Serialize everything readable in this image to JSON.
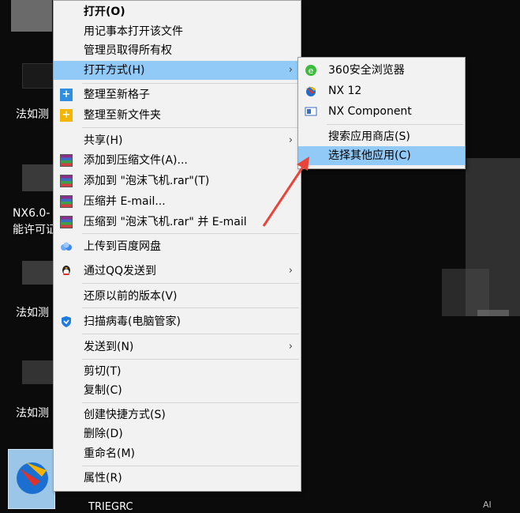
{
  "desktop": {
    "labels": [
      {
        "text": "法如测"
      },
      {
        "text": "NX6.0-"
      },
      {
        "text": "能许可证"
      },
      {
        "text": "法如测"
      },
      {
        "text": "法如测"
      },
      {
        "text": "TRIEGRC"
      }
    ],
    "watermark": "AI"
  },
  "context_menu": {
    "items": [
      {
        "label": "打开(O)",
        "bold": true
      },
      {
        "label": "用记事本打开该文件"
      },
      {
        "label": "管理员取得所有权"
      },
      {
        "label": "打开方式(H)",
        "submenu": true,
        "highlighted": true
      },
      {
        "label": "整理至新格子",
        "icon": "add-grid-icon"
      },
      {
        "label": "整理至新文件夹",
        "icon": "add-folder-icon"
      },
      {
        "label": "共享(H)",
        "submenu": true
      },
      {
        "label": "添加到压缩文件(A)...",
        "icon": "winrar-icon"
      },
      {
        "label": "添加到 \"泡沫飞机.rar\"(T)",
        "icon": "winrar-icon"
      },
      {
        "label": "压缩并 E-mail...",
        "icon": "winrar-icon"
      },
      {
        "label": "压缩到 \"泡沫飞机.rar\" 并 E-mail",
        "icon": "winrar-icon"
      },
      {
        "label": "上传到百度网盘",
        "icon": "baidu-cloud-icon"
      },
      {
        "label": "通过QQ发送到",
        "icon": "qq-icon",
        "submenu": true
      },
      {
        "label": "还原以前的版本(V)"
      },
      {
        "label": "扫描病毒(电脑管家)",
        "icon": "tencent-pc-manager-icon"
      },
      {
        "label": "发送到(N)",
        "submenu": true
      },
      {
        "label": "剪切(T)"
      },
      {
        "label": "复制(C)"
      },
      {
        "label": "创建快捷方式(S)"
      },
      {
        "label": "删除(D)"
      },
      {
        "label": "重命名(M)"
      },
      {
        "label": "属性(R)"
      }
    ]
  },
  "submenu": {
    "items": [
      {
        "label": "360安全浏览器",
        "icon": "360-browser-icon"
      },
      {
        "label": "NX 12",
        "icon": "nx-icon"
      },
      {
        "label": "NX Component",
        "icon": "nx-component-icon"
      },
      {
        "label": "搜索应用商店(S)"
      },
      {
        "label": "选择其他应用(C)",
        "highlighted": true
      }
    ]
  },
  "colors": {
    "menu_bg": "#f2f2f2",
    "highlight": "#91c9f7",
    "annotation_arrow": "#e8453a"
  }
}
